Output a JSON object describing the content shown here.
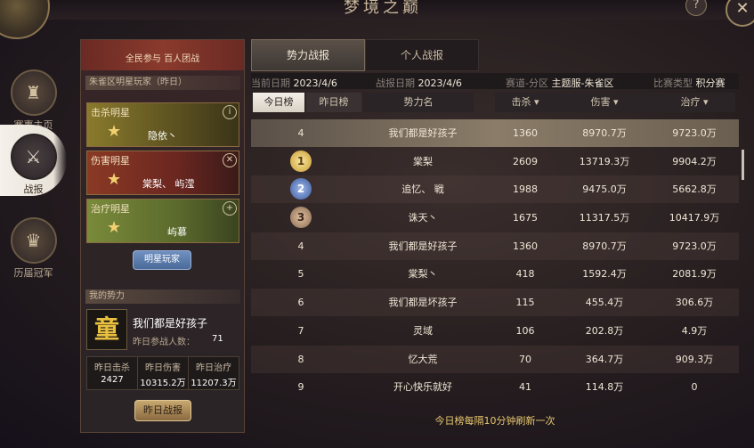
{
  "window": {
    "title": "梦境之巅",
    "help_icon": "?",
    "close_icon": "✕"
  },
  "nav": {
    "items": [
      {
        "label": "赛事主页",
        "icon": "helmet-icon",
        "glyph": "♜"
      },
      {
        "label": "战报",
        "icon": "crossed-swords-icon",
        "glyph": "⚔"
      },
      {
        "label": "历届冠军",
        "icon": "trophy-icon",
        "glyph": "♛"
      }
    ]
  },
  "left_panel": {
    "banner": "全民参与 百人团战",
    "star_section": "朱雀区明星玩家（昨日）",
    "cards": [
      {
        "label": "击杀明星",
        "name": "隐依丶",
        "icon": "i"
      },
      {
        "label": "伤害明星",
        "name": "棠梨、 屿滢",
        "icon": "✕"
      },
      {
        "label": "治疗明星",
        "name": "屿慕",
        "icon": "+"
      }
    ],
    "star_glyph": "★",
    "star_button": "明星玩家",
    "my_faction_head": "我的势力",
    "faction_emblem": "童",
    "faction_name": "我们都是好孩子",
    "count_label": "昨日参战人数：",
    "count_value": "71",
    "stats": [
      {
        "label": "昨日击杀",
        "value": "2427"
      },
      {
        "label": "昨日伤害",
        "value": "10315.2万"
      },
      {
        "label": "昨日治疗",
        "value": "11207.3万"
      }
    ],
    "yesterday_button": "昨日战报"
  },
  "tabs": {
    "faction": "势力战报",
    "personal": "个人战报"
  },
  "info": {
    "current_date_label": "当前日期",
    "current_date": "2023/4/6",
    "report_date_label": "战报日期",
    "report_date": "2023/4/6",
    "zone_label": "赛道-分区",
    "zone": "主题服-朱雀区",
    "match_type_label": "比赛类型",
    "match_type": "积分赛"
  },
  "toggle": {
    "today": "今日榜",
    "yesterday": "昨日榜"
  },
  "columns": {
    "name": "势力名",
    "kill": "击杀 ▾",
    "damage": "伤害 ▾",
    "heal": "治疗 ▾"
  },
  "rows": [
    {
      "rank": "4",
      "name": "我们都是好孩子",
      "kill": "1360",
      "damage": "8970.7万",
      "heal": "9723.0万"
    },
    {
      "rank": "1",
      "name": "棠梨",
      "kill": "2609",
      "damage": "13719.3万",
      "heal": "9904.2万"
    },
    {
      "rank": "2",
      "name": "追忆、 戦",
      "kill": "1988",
      "damage": "9475.0万",
      "heal": "5662.8万"
    },
    {
      "rank": "3",
      "name": "诛天丶",
      "kill": "1675",
      "damage": "11317.5万",
      "heal": "10417.9万"
    },
    {
      "rank": "4",
      "name": "我们都是好孩子",
      "kill": "1360",
      "damage": "8970.7万",
      "heal": "9723.0万"
    },
    {
      "rank": "5",
      "name": "棠梨丶",
      "kill": "418",
      "damage": "1592.4万",
      "heal": "2081.9万"
    },
    {
      "rank": "6",
      "name": "我们都是坏孩子",
      "kill": "115",
      "damage": "455.4万",
      "heal": "306.6万"
    },
    {
      "rank": "7",
      "name": "灵域",
      "kill": "106",
      "damage": "202.8万",
      "heal": "4.9万"
    },
    {
      "rank": "8",
      "name": "忆大荒",
      "kill": "70",
      "damage": "364.7万",
      "heal": "909.3万"
    },
    {
      "rank": "9",
      "name": "开心快乐就好",
      "kill": "41",
      "damage": "114.8万",
      "heal": "0"
    }
  ],
  "footer_note": "今日榜每隔10分钟刷新一次"
}
